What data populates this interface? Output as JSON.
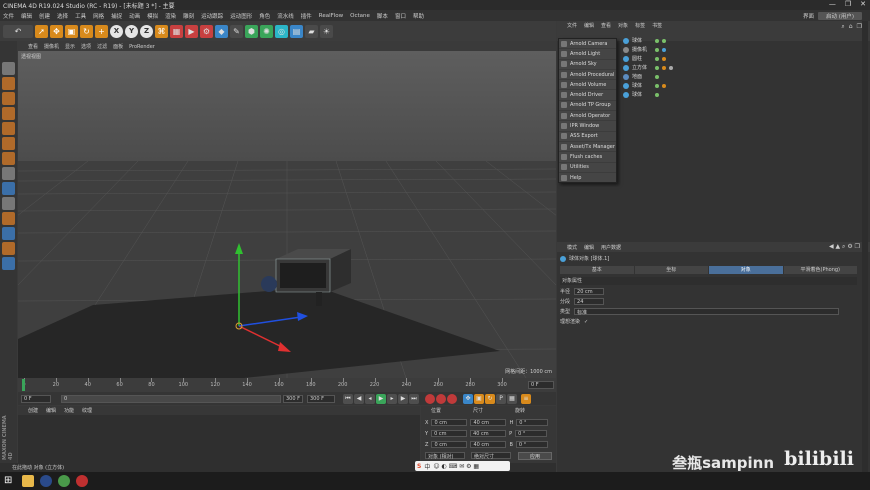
{
  "window": {
    "title": "CINEMA 4D R19.024 Studio (RC - R19) - [未标题 3 *] - 主要",
    "controls": [
      "—",
      "❐",
      "✕"
    ]
  },
  "menubar": {
    "items": [
      "文件",
      "编辑",
      "创建",
      "选择",
      "工具",
      "网格",
      "捕捉",
      "动画",
      "模拟",
      "渲染",
      "雕刻",
      "运动跟踪",
      "运动图形",
      "角色",
      "流水线",
      "插件",
      "RealFlow",
      "Octane",
      "脚本",
      "窗口",
      "帮助"
    ],
    "layout_label": "界面",
    "layout_value": "启动 (用户)"
  },
  "toolbar": {
    "icons": [
      "undo-icon",
      "arrow-icon",
      "move-icon",
      "scale-icon",
      "rotate-icon",
      "plus-icon",
      "x-axis-icon",
      "y-axis-icon",
      "z-axis-icon",
      "coord-icon",
      "render-region-icon",
      "render-view-icon",
      "render-settings-icon",
      "cube-icon",
      "pen-icon",
      "subdivision-icon",
      "cloner-icon",
      "deformer-icon",
      "floor-icon",
      "camera-icon",
      "light-icon"
    ],
    "xyz": [
      "X",
      "Y",
      "Z"
    ]
  },
  "viewport": {
    "menu": [
      "查看",
      "摄像机",
      "显示",
      "选项",
      "过滤",
      "面板",
      "ProRender"
    ],
    "label": "透视视图",
    "grid_label": "网格间距：1000 cm"
  },
  "timeline": {
    "ticks": [
      "0",
      "20",
      "40",
      "60",
      "80",
      "100",
      "120",
      "140",
      "160",
      "180",
      "200",
      "220",
      "240",
      "260",
      "280",
      "300"
    ],
    "end_field": "0 F"
  },
  "playbar": {
    "start": "0 F",
    "current": "0",
    "end_a": "300 F",
    "end_b": "300 F"
  },
  "material": {
    "menu": [
      "创建",
      "编辑",
      "功能",
      "纹理"
    ]
  },
  "coords": {
    "headers": [
      "位置",
      "尺寸",
      "旋转"
    ],
    "rows": [
      {
        "axis": "X",
        "pos": "0 cm",
        "size": "40 cm",
        "rot_axis": "H",
        "rot": "0 °"
      },
      {
        "axis": "Y",
        "pos": "0 cm",
        "size": "40 cm",
        "rot_axis": "P",
        "rot": "0 °"
      },
      {
        "axis": "Z",
        "pos": "0 cm",
        "size": "40 cm",
        "rot_axis": "B",
        "rot": "0 °"
      }
    ],
    "mode1": "对象 (相对)",
    "mode2": "绝对尺寸",
    "apply": "应用"
  },
  "status": {
    "text": "在此拖动 对象 (立方体)"
  },
  "objmanager": {
    "tabs": [
      "文件",
      "编辑",
      "查看",
      "对象",
      "标签",
      "书签"
    ],
    "objects": [
      {
        "name": "球体"
      },
      {
        "name": "摄像机"
      },
      {
        "name": "圆柱"
      },
      {
        "name": "立方体"
      },
      {
        "name": "地面"
      },
      {
        "name": "球体"
      },
      {
        "name": "球体"
      }
    ]
  },
  "arnold_menu": {
    "items": [
      "Arnold Camera",
      "Arnold Light",
      "Arnold Sky",
      "Arnold Procedural",
      "Arnold Volume",
      "Arnold Driver",
      "Arnold TP Group",
      "Arnold Operator",
      "IPR Window",
      "ASS Export",
      "Asset/Tx Manager",
      "Flush caches",
      "Utilities",
      "Help"
    ]
  },
  "attr": {
    "menu": [
      "模式",
      "编辑",
      "用户数据"
    ],
    "title": "球体对象 [球体.1]",
    "tabs": [
      "基本",
      "坐标",
      "对象",
      "平滑着色(Phong)"
    ],
    "section": "对象属性",
    "radius_label": "半径",
    "radius": "20 cm",
    "segments_label": "分段",
    "segments": "24",
    "type_label": "类型",
    "type": "标准",
    "perfect_label": "理想渲染",
    "perfect": "✓"
  },
  "watermark": {
    "user": "叁瓶sampinn",
    "brand": "bilibili"
  },
  "ime": {
    "label": "中"
  },
  "colors": {
    "accent": "#d88a1c",
    "selection": "#4a6f9a",
    "x_axis": "#e03030",
    "y_axis": "#30c030",
    "z_axis": "#2050e0"
  }
}
